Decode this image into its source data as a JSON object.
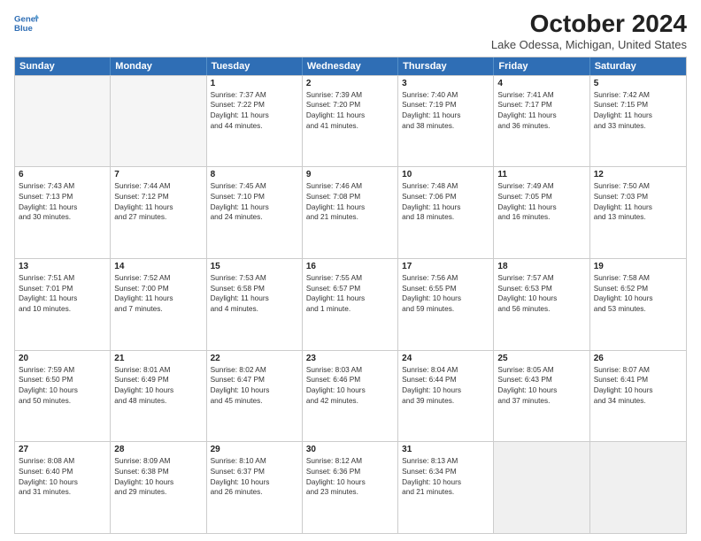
{
  "header": {
    "logo_line1": "General",
    "logo_line2": "Blue",
    "title": "October 2024",
    "subtitle": "Lake Odessa, Michigan, United States"
  },
  "days_of_week": [
    "Sunday",
    "Monday",
    "Tuesday",
    "Wednesday",
    "Thursday",
    "Friday",
    "Saturday"
  ],
  "weeks": [
    [
      {
        "day": "",
        "lines": [],
        "empty": true
      },
      {
        "day": "",
        "lines": [],
        "empty": true
      },
      {
        "day": "1",
        "lines": [
          "Sunrise: 7:37 AM",
          "Sunset: 7:22 PM",
          "Daylight: 11 hours",
          "and 44 minutes."
        ]
      },
      {
        "day": "2",
        "lines": [
          "Sunrise: 7:39 AM",
          "Sunset: 7:20 PM",
          "Daylight: 11 hours",
          "and 41 minutes."
        ]
      },
      {
        "day": "3",
        "lines": [
          "Sunrise: 7:40 AM",
          "Sunset: 7:19 PM",
          "Daylight: 11 hours",
          "and 38 minutes."
        ]
      },
      {
        "day": "4",
        "lines": [
          "Sunrise: 7:41 AM",
          "Sunset: 7:17 PM",
          "Daylight: 11 hours",
          "and 36 minutes."
        ]
      },
      {
        "day": "5",
        "lines": [
          "Sunrise: 7:42 AM",
          "Sunset: 7:15 PM",
          "Daylight: 11 hours",
          "and 33 minutes."
        ]
      }
    ],
    [
      {
        "day": "6",
        "lines": [
          "Sunrise: 7:43 AM",
          "Sunset: 7:13 PM",
          "Daylight: 11 hours",
          "and 30 minutes."
        ]
      },
      {
        "day": "7",
        "lines": [
          "Sunrise: 7:44 AM",
          "Sunset: 7:12 PM",
          "Daylight: 11 hours",
          "and 27 minutes."
        ]
      },
      {
        "day": "8",
        "lines": [
          "Sunrise: 7:45 AM",
          "Sunset: 7:10 PM",
          "Daylight: 11 hours",
          "and 24 minutes."
        ]
      },
      {
        "day": "9",
        "lines": [
          "Sunrise: 7:46 AM",
          "Sunset: 7:08 PM",
          "Daylight: 11 hours",
          "and 21 minutes."
        ]
      },
      {
        "day": "10",
        "lines": [
          "Sunrise: 7:48 AM",
          "Sunset: 7:06 PM",
          "Daylight: 11 hours",
          "and 18 minutes."
        ]
      },
      {
        "day": "11",
        "lines": [
          "Sunrise: 7:49 AM",
          "Sunset: 7:05 PM",
          "Daylight: 11 hours",
          "and 16 minutes."
        ]
      },
      {
        "day": "12",
        "lines": [
          "Sunrise: 7:50 AM",
          "Sunset: 7:03 PM",
          "Daylight: 11 hours",
          "and 13 minutes."
        ]
      }
    ],
    [
      {
        "day": "13",
        "lines": [
          "Sunrise: 7:51 AM",
          "Sunset: 7:01 PM",
          "Daylight: 11 hours",
          "and 10 minutes."
        ]
      },
      {
        "day": "14",
        "lines": [
          "Sunrise: 7:52 AM",
          "Sunset: 7:00 PM",
          "Daylight: 11 hours",
          "and 7 minutes."
        ]
      },
      {
        "day": "15",
        "lines": [
          "Sunrise: 7:53 AM",
          "Sunset: 6:58 PM",
          "Daylight: 11 hours",
          "and 4 minutes."
        ]
      },
      {
        "day": "16",
        "lines": [
          "Sunrise: 7:55 AM",
          "Sunset: 6:57 PM",
          "Daylight: 11 hours",
          "and 1 minute."
        ]
      },
      {
        "day": "17",
        "lines": [
          "Sunrise: 7:56 AM",
          "Sunset: 6:55 PM",
          "Daylight: 10 hours",
          "and 59 minutes."
        ]
      },
      {
        "day": "18",
        "lines": [
          "Sunrise: 7:57 AM",
          "Sunset: 6:53 PM",
          "Daylight: 10 hours",
          "and 56 minutes."
        ]
      },
      {
        "day": "19",
        "lines": [
          "Sunrise: 7:58 AM",
          "Sunset: 6:52 PM",
          "Daylight: 10 hours",
          "and 53 minutes."
        ]
      }
    ],
    [
      {
        "day": "20",
        "lines": [
          "Sunrise: 7:59 AM",
          "Sunset: 6:50 PM",
          "Daylight: 10 hours",
          "and 50 minutes."
        ]
      },
      {
        "day": "21",
        "lines": [
          "Sunrise: 8:01 AM",
          "Sunset: 6:49 PM",
          "Daylight: 10 hours",
          "and 48 minutes."
        ]
      },
      {
        "day": "22",
        "lines": [
          "Sunrise: 8:02 AM",
          "Sunset: 6:47 PM",
          "Daylight: 10 hours",
          "and 45 minutes."
        ]
      },
      {
        "day": "23",
        "lines": [
          "Sunrise: 8:03 AM",
          "Sunset: 6:46 PM",
          "Daylight: 10 hours",
          "and 42 minutes."
        ]
      },
      {
        "day": "24",
        "lines": [
          "Sunrise: 8:04 AM",
          "Sunset: 6:44 PM",
          "Daylight: 10 hours",
          "and 39 minutes."
        ]
      },
      {
        "day": "25",
        "lines": [
          "Sunrise: 8:05 AM",
          "Sunset: 6:43 PM",
          "Daylight: 10 hours",
          "and 37 minutes."
        ]
      },
      {
        "day": "26",
        "lines": [
          "Sunrise: 8:07 AM",
          "Sunset: 6:41 PM",
          "Daylight: 10 hours",
          "and 34 minutes."
        ]
      }
    ],
    [
      {
        "day": "27",
        "lines": [
          "Sunrise: 8:08 AM",
          "Sunset: 6:40 PM",
          "Daylight: 10 hours",
          "and 31 minutes."
        ]
      },
      {
        "day": "28",
        "lines": [
          "Sunrise: 8:09 AM",
          "Sunset: 6:38 PM",
          "Daylight: 10 hours",
          "and 29 minutes."
        ]
      },
      {
        "day": "29",
        "lines": [
          "Sunrise: 8:10 AM",
          "Sunset: 6:37 PM",
          "Daylight: 10 hours",
          "and 26 minutes."
        ]
      },
      {
        "day": "30",
        "lines": [
          "Sunrise: 8:12 AM",
          "Sunset: 6:36 PM",
          "Daylight: 10 hours",
          "and 23 minutes."
        ]
      },
      {
        "day": "31",
        "lines": [
          "Sunrise: 8:13 AM",
          "Sunset: 6:34 PM",
          "Daylight: 10 hours",
          "and 21 minutes."
        ]
      },
      {
        "day": "",
        "lines": [],
        "empty": true,
        "shaded": true
      },
      {
        "day": "",
        "lines": [],
        "empty": true,
        "shaded": true
      }
    ]
  ]
}
